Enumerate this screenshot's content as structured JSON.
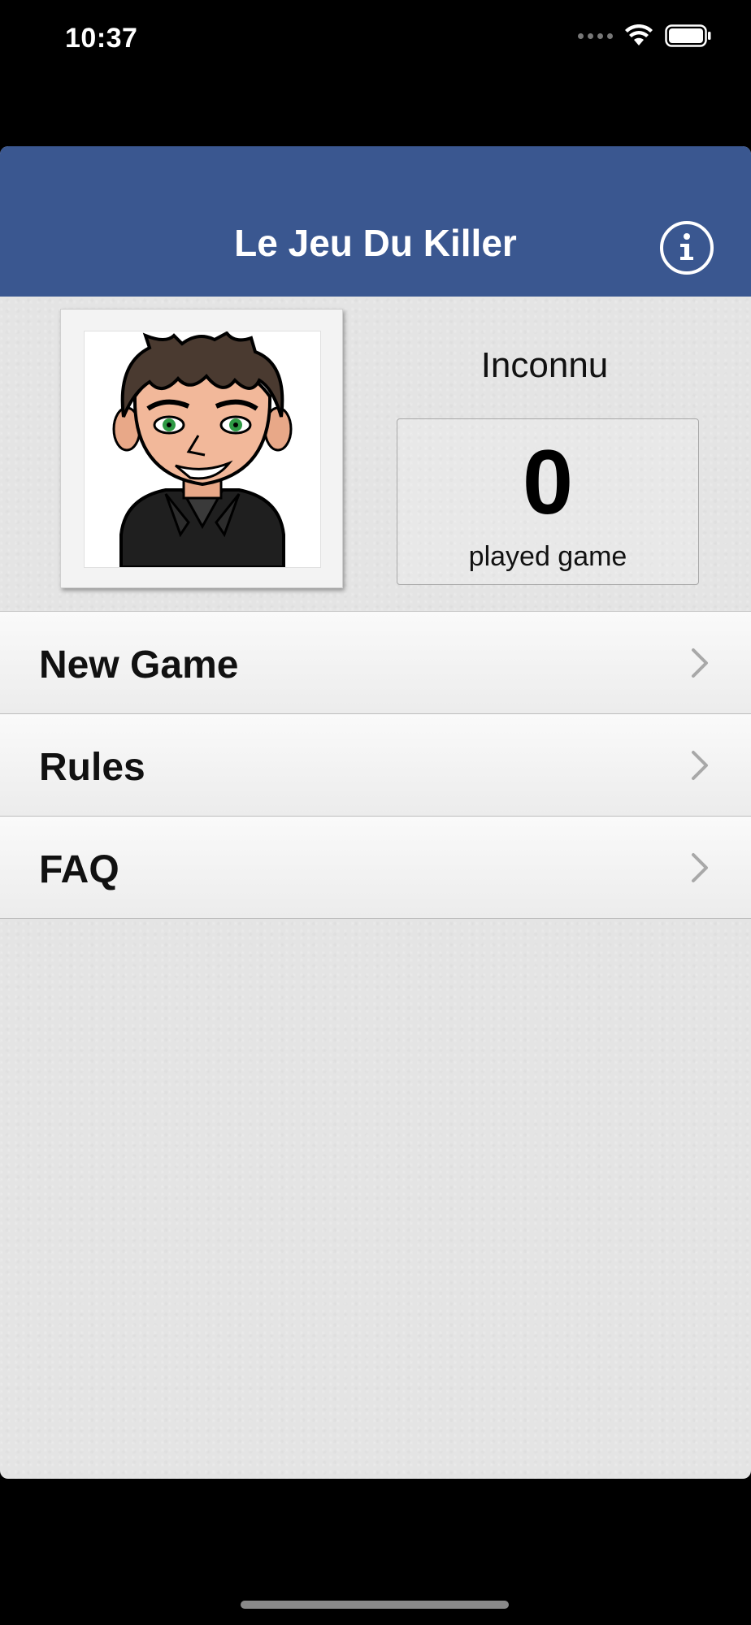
{
  "status_bar": {
    "time": "10:37",
    "icons": [
      "signal-icon",
      "wifi-icon",
      "battery-icon"
    ]
  },
  "nav": {
    "title": "Le Jeu Du Killer",
    "info_icon": "info-icon"
  },
  "profile": {
    "name": "Inconnu",
    "played_count": "0",
    "played_label": "played game"
  },
  "menu": {
    "items": [
      {
        "label": "New Game",
        "icon": "chevron-right-icon"
      },
      {
        "label": "Rules",
        "icon": "chevron-right-icon"
      },
      {
        "label": "FAQ",
        "icon": "chevron-right-icon"
      }
    ]
  },
  "colors": {
    "nav_bar": "#3a5790",
    "background": "#e4e4e4",
    "screen_background": "#000000"
  }
}
